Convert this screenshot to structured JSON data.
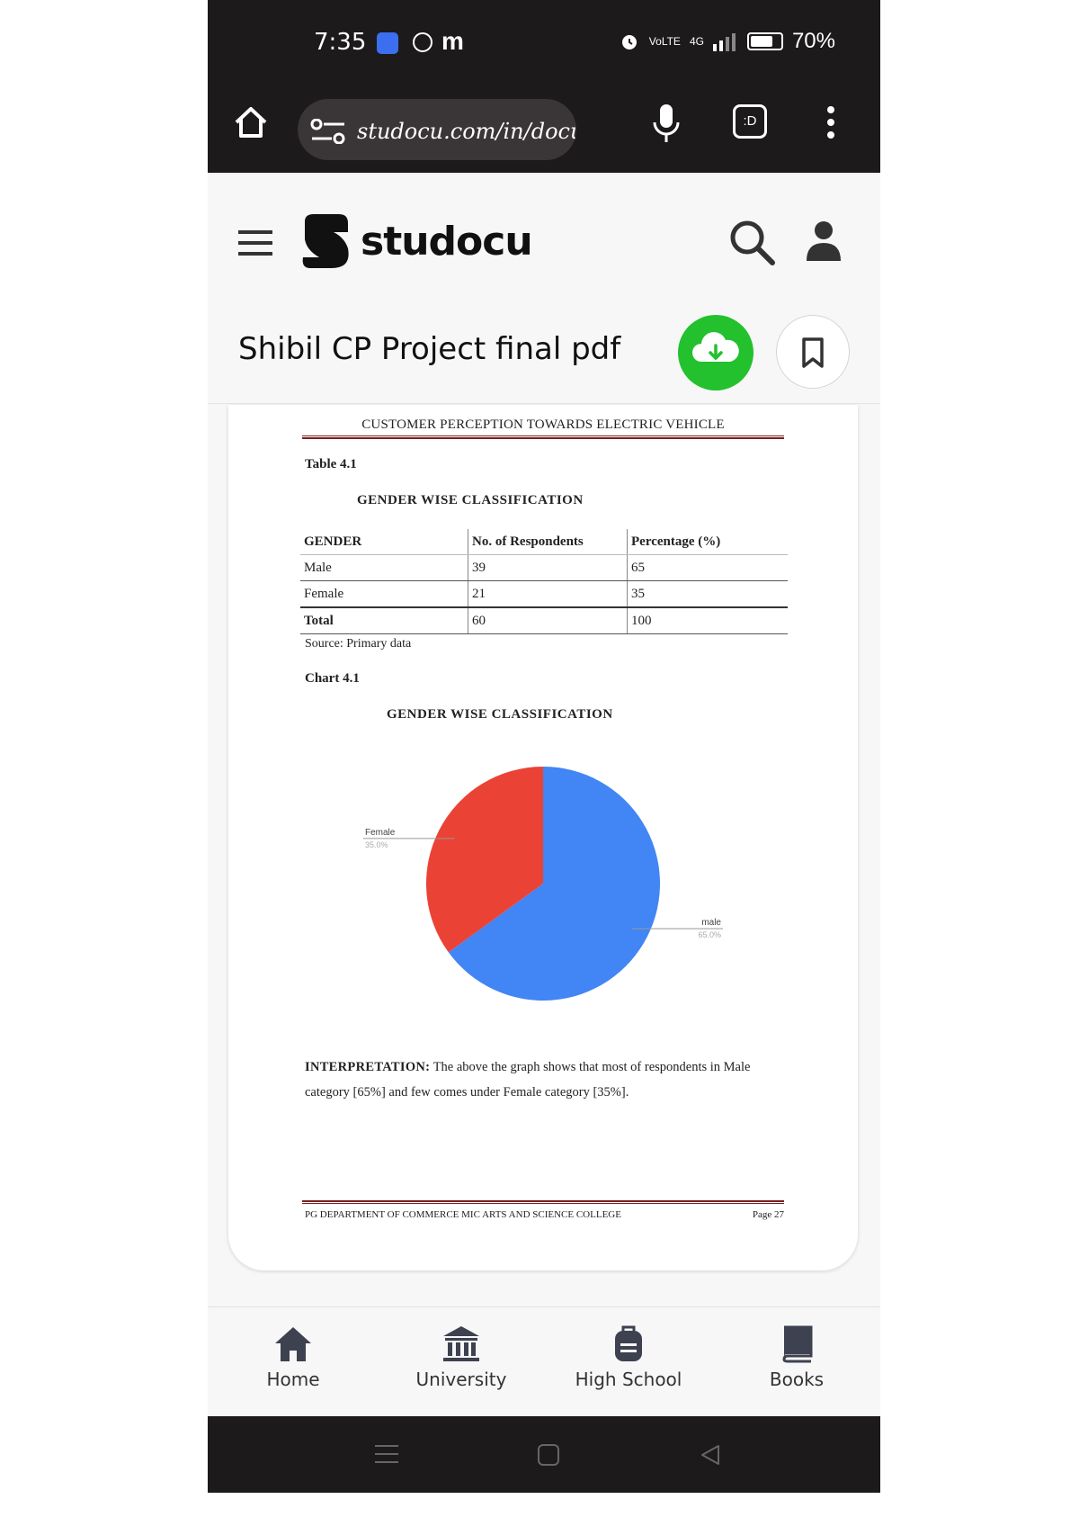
{
  "status_bar": {
    "time": "7:35",
    "app_badge": "m",
    "network": "VoLTE",
    "signal": "4G",
    "battery": "70%"
  },
  "browser": {
    "url": "studocu.com/in/docum",
    "tabs_label": ":D"
  },
  "site": {
    "logo": "studocu",
    "document_title": "Shibil CP Project final pdf"
  },
  "document": {
    "header": "CUSTOMER PERCEPTION TOWARDS ELECTRIC VEHICLE",
    "table_label": "Table 4.1",
    "table_title": "GENDER WISE CLASSIFICATION",
    "table": {
      "headers": [
        "GENDER",
        "No. of Respondents",
        "Percentage (%)"
      ],
      "rows": [
        [
          "Male",
          "39",
          "65"
        ],
        [
          "Female",
          "21",
          "35"
        ],
        [
          "Total",
          "60",
          "100"
        ]
      ]
    },
    "source": "Source: Primary data",
    "chart_label": "Chart 4.1",
    "chart_title": "GENDER WISE CLASSIFICATION",
    "interpretation_label": "INTERPRETATION:",
    "interpretation": "The above the graph shows that most of respondents in Male category [65%] and few comes under Female category [35%].",
    "footer_left": "PG DEPARTMENT OF COMMERCE MIC ARTS AND SCIENCE COLLEGE",
    "footer_right": "Page 27"
  },
  "chart_data": {
    "type": "pie",
    "title": "GENDER WISE CLASSIFICATION",
    "categories": [
      "male",
      "Female"
    ],
    "values": [
      65.0,
      35.0
    ],
    "labels": [
      "65.0%",
      "35.0%"
    ],
    "colors": [
      "#4285f4",
      "#ea4335"
    ]
  },
  "bottom_nav": [
    {
      "label": "Home"
    },
    {
      "label": "University"
    },
    {
      "label": "High School"
    },
    {
      "label": "Books"
    }
  ]
}
